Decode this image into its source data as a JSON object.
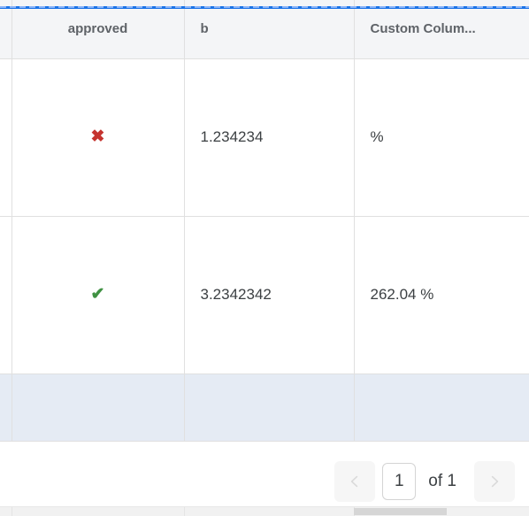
{
  "indicator": {
    "name": "column-drop-indicator",
    "color": "#1a73e8",
    "dash_color": "#8ab4f8"
  },
  "grid": {
    "columns": [
      {
        "key": "gutter",
        "label": "",
        "align": "left"
      },
      {
        "key": "approved",
        "label": "approved",
        "align": "center"
      },
      {
        "key": "b",
        "label": "b",
        "align": "left"
      },
      {
        "key": "custom",
        "label": "Custom Colum...",
        "align": "left"
      }
    ],
    "rows": [
      {
        "approved": "✖",
        "approved_state": "false",
        "b": "1.234234",
        "custom": "%"
      },
      {
        "approved": "✔",
        "approved_state": "true",
        "b": "3.2342342",
        "custom": "262.04 %"
      }
    ],
    "empty_row": {
      "selected": true,
      "background": "#e5ebf4",
      "approved": "",
      "b": "",
      "custom": ""
    },
    "colors": {
      "header_background": "#f4f5f7",
      "header_text": "#5f6368",
      "cell_text": "#3c4043",
      "border": "#e0e0e0",
      "check_yes": "#3f9142",
      "check_no": "#c5342f"
    }
  },
  "pagination": {
    "previous_label": "‹",
    "next_label": "›",
    "page_value": "1",
    "page_placeholder": "1",
    "of_label": "of 1",
    "total_pages": "1",
    "previous_disabled": true,
    "next_disabled": true
  },
  "scrollbar": {
    "orientation": "horizontal",
    "thumb_position": "400",
    "thumb_width": "105"
  }
}
